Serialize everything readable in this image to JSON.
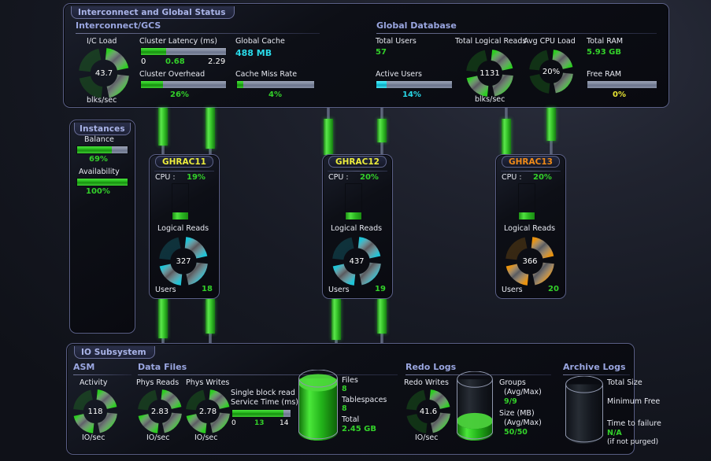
{
  "panels": {
    "interconnect": {
      "title": "Interconnect and Global Status"
    },
    "instances": {
      "title": "Instances"
    },
    "io": {
      "title": "IO Subsystem"
    }
  },
  "sections": {
    "interconnect_gcs": "Interconnect/GCS",
    "global_database": "Global Database",
    "asm": "ASM",
    "data_files": "Data Files",
    "redo_logs": "Redo Logs",
    "archive_logs": "Archive Logs"
  },
  "interconnect": {
    "ic_load": {
      "label": "I/C Load",
      "value": "43.7",
      "unit": "blks/sec",
      "percent": 44,
      "color": "#2ecc23"
    },
    "cluster_latency": {
      "label": "Cluster Latency (ms)",
      "min": "0",
      "value": "0.68",
      "max": "2.29",
      "percent": 30
    },
    "cluster_overhead": {
      "label": "Cluster Overhead",
      "value": "26%",
      "percent": 26
    },
    "global_cache": {
      "label": "Global Cache",
      "value": "488 MB"
    },
    "cache_miss_rate": {
      "label": "Cache Miss Rate",
      "value": "4%",
      "percent": 8
    }
  },
  "global_database": {
    "total_users": {
      "label": "Total Users",
      "value": "57"
    },
    "active_users": {
      "label": "Active Users",
      "value": "14%",
      "percent": 14
    },
    "total_logical_reads": {
      "label": "Total Logical Reads",
      "value": "1131",
      "unit": "blks/sec",
      "percent": 62
    },
    "avg_cpu_load": {
      "label": "Avg CPU Load",
      "value": "20%",
      "percent": 55
    },
    "total_ram": {
      "label": "Total RAM",
      "value": "5.93 GB"
    },
    "free_ram": {
      "label": "Free RAM",
      "value": "0%",
      "percent": 0
    }
  },
  "instances_panel": {
    "balance": {
      "label": "Balance",
      "value": "69%",
      "percent": 69
    },
    "availability": {
      "label": "Availability",
      "value": "100%",
      "percent": 100
    }
  },
  "instances": [
    {
      "name": "GHRAC11",
      "state": "normal",
      "cpu_label": "CPU :",
      "cpu_value": "19%",
      "cpu_percent": 19,
      "reads_label": "Logical Reads",
      "reads_value": "327",
      "reads_percent": 62,
      "reads_color": "#1fc3d6",
      "users_label": "Users",
      "users_value": "18"
    },
    {
      "name": "GHRAC12",
      "state": "normal",
      "cpu_label": "CPU :",
      "cpu_value": "20%",
      "cpu_percent": 20,
      "reads_label": "Logical Reads",
      "reads_value": "437",
      "reads_percent": 70,
      "reads_color": "#1fc3d6",
      "users_label": "Users",
      "users_value": "19"
    },
    {
      "name": "GHRAC13",
      "state": "warning",
      "cpu_label": "CPU :",
      "cpu_value": "20%",
      "cpu_percent": 20,
      "reads_label": "Logical Reads",
      "reads_value": "366",
      "reads_percent": 66,
      "reads_color": "#e8920f",
      "users_label": "Users",
      "users_value": "20"
    }
  ],
  "io": {
    "asm_activity": {
      "label": "Activity",
      "value": "118",
      "unit": "IO/sec",
      "percent": 58
    },
    "phys_reads": {
      "label": "Phys Reads",
      "value": "2.83",
      "unit": "IO/sec",
      "percent": 60
    },
    "phys_writes": {
      "label": "Phys Writes",
      "value": "2.78",
      "unit": "IO/sec",
      "percent": 60
    },
    "single_block_read": {
      "label_line1": "Single block read",
      "label_line2": "Service Time (ms)",
      "min": "0",
      "value": "13",
      "max": "14",
      "percent": 88
    },
    "data_files": {
      "files_label": "Files",
      "files_value": "8",
      "tablespaces_label": "Tablespaces",
      "tablespaces_value": "8",
      "total_label": "Total",
      "total_value": "2.45 GB",
      "fill_percent": 92
    },
    "redo_writes": {
      "label": "Redo Writes",
      "value": "41.6",
      "unit": "IO/sec",
      "percent": 55
    },
    "redo_cylinder": {
      "groups_label": "Groups",
      "groups_sub": "(Avg/Max)",
      "groups_value": "9/9",
      "size_label": "Size (MB)",
      "size_sub": "(Avg/Max)",
      "size_value": "50/50",
      "fill_percent": 22
    },
    "archive_logs": {
      "total_size_label": "Total Size",
      "minimum_free_label": "Minimum Free",
      "time_to_failure_label": "Time to failure",
      "time_to_failure_value": "N/A",
      "time_to_failure_note": "(if not purged)",
      "fill_percent": 0
    }
  }
}
